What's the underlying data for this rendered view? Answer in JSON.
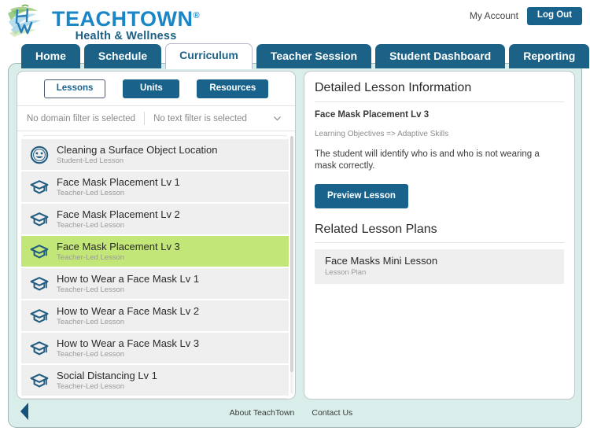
{
  "header": {
    "brand_name": "TEACHTOWN",
    "brand_tm": "®",
    "brand_sub": "Health & Wellness",
    "logo_icon": "leaf-hw-monogram-logo",
    "my_account": "My Account",
    "logout_label": "Log Out"
  },
  "nav": {
    "tabs": [
      {
        "label": "Home",
        "active": false
      },
      {
        "label": "Schedule",
        "active": false
      },
      {
        "label": "Curriculum",
        "active": true
      },
      {
        "label": "Teacher Session",
        "active": false
      },
      {
        "label": "Student Dashboard",
        "active": false
      },
      {
        "label": "Reporting",
        "active": false
      }
    ]
  },
  "left_panel": {
    "segments": [
      {
        "label": "Lessons",
        "selected": true
      },
      {
        "label": "Units",
        "selected": false
      },
      {
        "label": "Resources",
        "selected": false
      }
    ],
    "filters": {
      "domain_filter": "No domain filter is selected",
      "text_filter": "No text filter is selected",
      "chevron_icon": "chevron-down-icon"
    },
    "lessons": [
      {
        "title": "Cleaning a Surface Object Location",
        "subtitle": "Student-Led Lesson",
        "icon": "smiley-face-icon",
        "selected": false
      },
      {
        "title": "Face Mask Placement Lv 1",
        "subtitle": "Teacher-Led Lesson",
        "icon": "graduation-cap-icon",
        "selected": false
      },
      {
        "title": "Face Mask Placement Lv 2",
        "subtitle": "Teacher-Led Lesson",
        "icon": "graduation-cap-icon",
        "selected": false
      },
      {
        "title": "Face Mask Placement Lv 3",
        "subtitle": "Teacher-Led Lesson",
        "icon": "graduation-cap-icon",
        "selected": true
      },
      {
        "title": "How to Wear a Face Mask Lv 1",
        "subtitle": "Teacher-Led Lesson",
        "icon": "graduation-cap-icon",
        "selected": false
      },
      {
        "title": "How to Wear a Face Mask Lv 2",
        "subtitle": "Teacher-Led Lesson",
        "icon": "graduation-cap-icon",
        "selected": false
      },
      {
        "title": "How to Wear a Face Mask Lv 3",
        "subtitle": "Teacher-Led Lesson",
        "icon": "graduation-cap-icon",
        "selected": false
      },
      {
        "title": "Social Distancing Lv 1",
        "subtitle": "Teacher-Led Lesson",
        "icon": "graduation-cap-icon",
        "selected": false
      }
    ]
  },
  "right_panel": {
    "detail_heading": "Detailed Lesson Information",
    "lesson_name": "Face Mask Placement Lv 3",
    "objectives": "Learning Objectives => Adaptive Skills",
    "description": "The student will identify who is and who is not wearing a mask correctly.",
    "preview_label": "Preview Lesson",
    "related_heading": "Related Lesson Plans",
    "related_plans": [
      {
        "title": "Face Masks Mini Lesson",
        "subtitle": "Lesson Plan"
      }
    ]
  },
  "footer": {
    "back_icon": "back-arrow-icon",
    "links": [
      {
        "label": "About TeachTown"
      },
      {
        "label": "Contact Us"
      }
    ]
  },
  "colors": {
    "brand_blue": "#1b86c6",
    "brand_dark_teal": "#1c5f84",
    "tab_teal": "#1c6287",
    "button_blue": "#19628c",
    "shell_mint": "#d9eeea",
    "selected_green": "#c3e678",
    "row_gray": "#efefef"
  }
}
